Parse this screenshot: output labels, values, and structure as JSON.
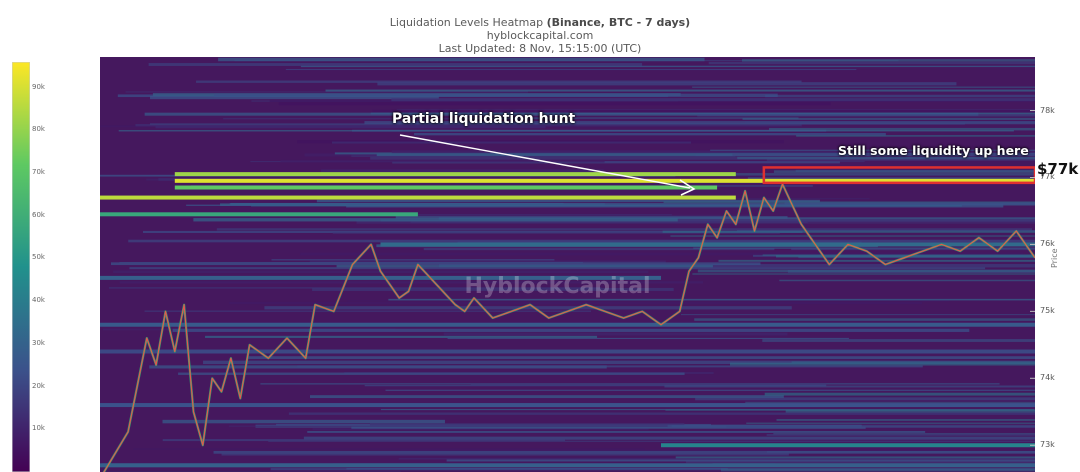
{
  "header": {
    "title_prefix": "Liquidation Levels Heatmap ",
    "title_bold": "(Binance, BTC - 7 days)",
    "source": "hyblockcapital.com",
    "last_updated": "Last Updated: 8 Nov, 15:15:00 (UTC)"
  },
  "colorbar": {
    "ticks": [
      "90k",
      "80k",
      "70k",
      "60k",
      "50k",
      "40k",
      "30k",
      "20k",
      "10k"
    ],
    "colors": [
      "#440154",
      "#3b528b",
      "#21918c",
      "#5ec962",
      "#fde725"
    ]
  },
  "annotations": {
    "hunt_label": "Partial liquidation hunt",
    "liquidity_label": "Still some liquidity up here",
    "price_callout": "$77k",
    "watermark": "HyblockCapital",
    "highlight_color": "#e03030",
    "arrow_color": "#ffffff"
  },
  "chart_data": {
    "type": "heatmap",
    "title": "Liquidation Levels Heatmap (Binance, BTC - 7 days)",
    "ylabel": "Price",
    "ylim": [
      72600,
      78800
    ],
    "y_ticks": [
      "78k",
      "77k",
      "76k",
      "75k",
      "74k",
      "73k"
    ],
    "y_tick_values": [
      78000,
      77000,
      76000,
      75000,
      74000,
      73000
    ],
    "colorscale": "viridis",
    "color_range": [
      0,
      100000
    ],
    "x_range": [
      0,
      100
    ],
    "price_series": {
      "x": [
        0,
        3,
        5,
        6,
        7,
        8,
        9,
        10,
        11,
        12,
        13,
        14,
        15,
        16,
        18,
        20,
        22,
        23,
        25,
        27,
        29,
        30,
        31,
        32,
        33,
        34,
        36,
        38,
        39,
        40,
        42,
        44,
        46,
        48,
        50,
        52,
        54,
        56,
        58,
        60,
        61,
        62,
        63,
        64,
        65,
        66,
        67,
        68,
        69,
        70,
        71,
        72,
        73,
        74,
        75,
        76,
        78,
        80,
        82,
        84,
        86,
        88,
        90,
        92,
        94,
        96,
        98,
        100
      ],
      "y": [
        72500,
        73200,
        74600,
        74200,
        75000,
        74400,
        75100,
        73500,
        73000,
        74000,
        73800,
        74300,
        73700,
        74500,
        74300,
        74600,
        74300,
        75100,
        75000,
        75700,
        76000,
        75600,
        75400,
        75200,
        75300,
        75700,
        75400,
        75100,
        75000,
        75200,
        74900,
        75000,
        75100,
        74900,
        75000,
        75100,
        75000,
        74900,
        75000,
        74800,
        74900,
        75000,
        75600,
        75800,
        76300,
        76100,
        76500,
        76300,
        76800,
        76200,
        76700,
        76500,
        76900,
        76600,
        76300,
        76100,
        75700,
        76000,
        75900,
        75700,
        75800,
        75900,
        76000,
        75900,
        76100,
        75900,
        76200,
        75800
      ]
    },
    "bands": [
      {
        "price": 77050,
        "x_start": 8,
        "x_end": 68,
        "intensity": 85000
      },
      {
        "price": 76950,
        "x_start": 8,
        "x_end": 100,
        "intensity": 95000
      },
      {
        "price": 76850,
        "x_start": 8,
        "x_end": 66,
        "intensity": 75000
      },
      {
        "price": 76700,
        "x_start": 0,
        "x_end": 68,
        "intensity": 90000
      },
      {
        "price": 76450,
        "x_start": 0,
        "x_end": 34,
        "intensity": 60000
      },
      {
        "price": 76000,
        "x_start": 30,
        "x_end": 100,
        "intensity": 35000
      },
      {
        "price": 75500,
        "x_start": 0,
        "x_end": 60,
        "intensity": 30000
      },
      {
        "price": 74800,
        "x_start": 0,
        "x_end": 100,
        "intensity": 28000
      },
      {
        "price": 74400,
        "x_start": 0,
        "x_end": 100,
        "intensity": 22000
      },
      {
        "price": 73600,
        "x_start": 0,
        "x_end": 100,
        "intensity": 25000
      },
      {
        "price": 73000,
        "x_start": 60,
        "x_end": 100,
        "intensity": 45000
      },
      {
        "price": 72700,
        "x_start": 0,
        "x_end": 100,
        "intensity": 30000
      }
    ],
    "highlight_region": {
      "price_low": 76920,
      "price_high": 77150,
      "x_start": 71,
      "x_end": 100
    }
  }
}
